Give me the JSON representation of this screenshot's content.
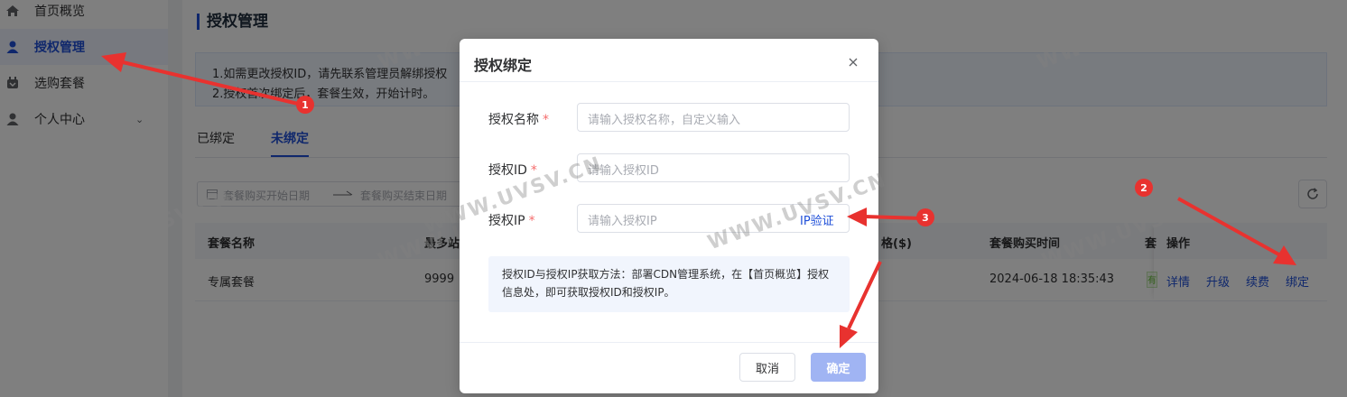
{
  "sidebar": {
    "items": [
      {
        "label": "首页概览",
        "icon": "home-icon"
      },
      {
        "label": "授权管理",
        "icon": "user-badge-icon"
      },
      {
        "label": "选购套餐",
        "icon": "package-icon"
      },
      {
        "label": "个人中心",
        "icon": "person-icon"
      }
    ]
  },
  "page": {
    "title": "授权管理",
    "notice": [
      "1.如需更改授权ID，请先联系管理员解绑授权",
      "2.授权首次绑定后，套餐生效，开始计时。"
    ],
    "tabs": [
      "已绑定",
      "未绑定"
    ],
    "active_tab": "未绑定"
  },
  "filter": {
    "start_placeholder": "套餐购买开始日期",
    "end_placeholder": "套餐购买结束日期"
  },
  "table": {
    "headers": {
      "name": "套餐名称",
      "max_sites": "最多站",
      "price": "格($)",
      "purchase_time": "套餐购买时间",
      "status": "套",
      "actions": "操作"
    },
    "rows": [
      {
        "name": "专属套餐",
        "max_sites": "9999",
        "purchase_time": "2024-06-18 18:35:43",
        "status_fragment": "有",
        "actions": [
          "详情",
          "升级",
          "续费",
          "绑定"
        ]
      }
    ]
  },
  "dialog": {
    "title": "授权绑定",
    "fields": [
      {
        "label": "授权名称",
        "placeholder": "请输入授权名称，自定义输入"
      },
      {
        "label": "授权ID",
        "placeholder": "请输入授权ID"
      },
      {
        "label": "授权IP",
        "placeholder": "请输入授权IP"
      }
    ],
    "required_mark": "*",
    "ip_verify_label": "IP验证",
    "help_text": "授权ID与授权IP获取方法：部署CDN管理系统，在【首页概览】授权信息处，即可获取授权ID和授权IP。",
    "cancel_label": "取消",
    "confirm_label": "确定"
  },
  "watermark": "WWW.UVSV.CN",
  "annotations": {
    "markers": [
      "1",
      "2",
      "3"
    ],
    "color": "#e8322f"
  },
  "colors": {
    "primary": "#1f4fd8",
    "primary_disabled": "#a0b4f3",
    "required": "#f56c6c"
  }
}
